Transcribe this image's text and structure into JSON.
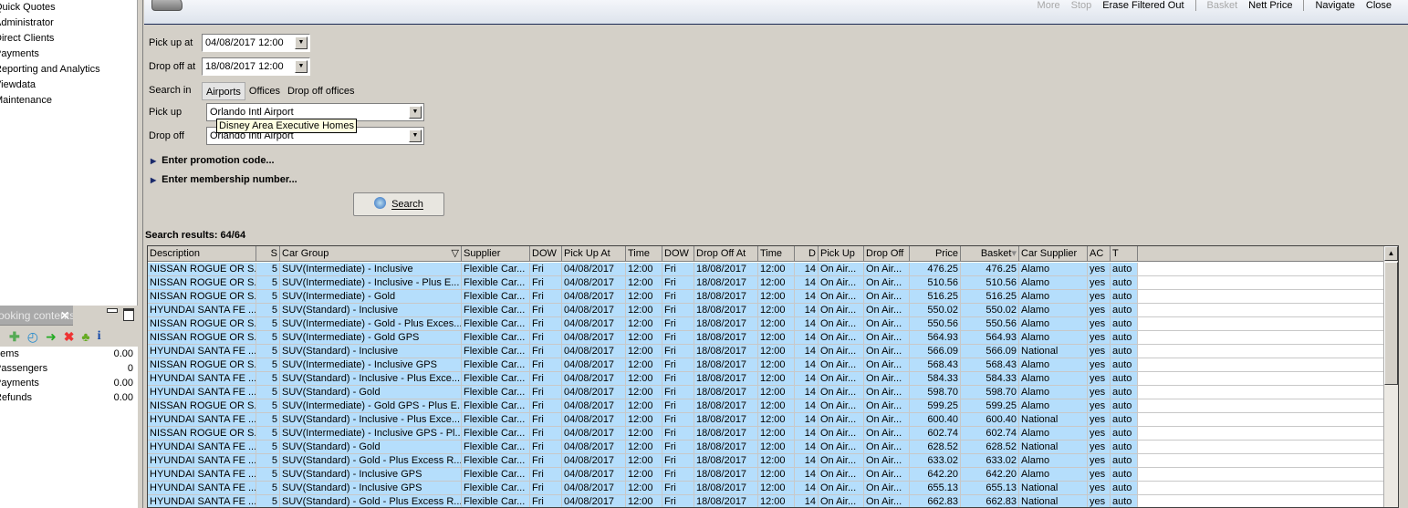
{
  "nav": {
    "items": [
      "Quick Quotes",
      "Administrator",
      "Direct Clients",
      "Payments",
      "Reporting and Analytics",
      "Viewdata",
      "Maintenance"
    ]
  },
  "booking_panel": {
    "tab_label": "Booking contents",
    "tools": [
      "add-icon",
      "clock-icon",
      "cart-transfer-icon",
      "delete-icon",
      "palm-island-icon",
      "info-icon"
    ],
    "rows": [
      {
        "label": "Items",
        "value": "0.00"
      },
      {
        "label": "Passengers",
        "value": "0"
      },
      {
        "label": "Payments",
        "value": "0.00"
      },
      {
        "label": "Refunds",
        "value": "0.00"
      }
    ]
  },
  "toolbar": {
    "more": "More",
    "stop": "Stop",
    "erase": "Erase Filtered Out",
    "basket": "Basket",
    "nett": "Nett Price",
    "navigate": "Navigate",
    "close": "Close"
  },
  "form": {
    "pickup_at_label": "Pick up at",
    "pickup_at": "04/08/2017 12:00",
    "dropoff_at_label": "Drop off at",
    "dropoff_at": "18/08/2017 12:00",
    "search_in_label": "Search in",
    "search_in_options": [
      "Airports",
      "Offices",
      "Drop off offices"
    ],
    "search_in_selected": "Airports",
    "pickup_label": "Pick up",
    "pickup": "Orlando Intl Airport",
    "dropoff_label": "Drop off",
    "dropoff": "Orlando Intl Airport",
    "tooltip": "Disney Area Executive Homes",
    "promo": "Enter promotion code...",
    "membership": "Enter membership number...",
    "search_button": "Search"
  },
  "results": {
    "title": "Search results: 64/64",
    "columns": [
      "Description",
      "S",
      "Car Group",
      "Supplier",
      "DOW",
      "Pick Up At",
      "Time",
      "DOW",
      "Drop Off At",
      "Time",
      "D",
      "Pick Up",
      "Drop Off",
      "Price",
      "Basket",
      "Car Supplier",
      "AC",
      "T"
    ],
    "rows": [
      [
        "NISSAN ROGUE OR S...",
        "5",
        "SUV(Intermediate) - Inclusive",
        "Flexible Car...",
        "Fri",
        "04/08/2017",
        "12:00",
        "Fri",
        "18/08/2017",
        "12:00",
        "14",
        "On Air...",
        "On Air...",
        "476.25",
        "476.25",
        "Alamo",
        "yes",
        "auto"
      ],
      [
        "NISSAN ROGUE OR S...",
        "5",
        "SUV(Intermediate) - Inclusive - Plus E...",
        "Flexible Car...",
        "Fri",
        "04/08/2017",
        "12:00",
        "Fri",
        "18/08/2017",
        "12:00",
        "14",
        "On Air...",
        "On Air...",
        "510.56",
        "510.56",
        "Alamo",
        "yes",
        "auto"
      ],
      [
        "NISSAN ROGUE OR S...",
        "5",
        "SUV(Intermediate) - Gold",
        "Flexible Car...",
        "Fri",
        "04/08/2017",
        "12:00",
        "Fri",
        "18/08/2017",
        "12:00",
        "14",
        "On Air...",
        "On Air...",
        "516.25",
        "516.25",
        "Alamo",
        "yes",
        "auto"
      ],
      [
        "HYUNDAI SANTA FE ...",
        "5",
        "SUV(Standard) - Inclusive",
        "Flexible Car...",
        "Fri",
        "04/08/2017",
        "12:00",
        "Fri",
        "18/08/2017",
        "12:00",
        "14",
        "On Air...",
        "On Air...",
        "550.02",
        "550.02",
        "Alamo",
        "yes",
        "auto"
      ],
      [
        "NISSAN ROGUE OR S...",
        "5",
        "SUV(Intermediate) - Gold - Plus Exces...",
        "Flexible Car...",
        "Fri",
        "04/08/2017",
        "12:00",
        "Fri",
        "18/08/2017",
        "12:00",
        "14",
        "On Air...",
        "On Air...",
        "550.56",
        "550.56",
        "Alamo",
        "yes",
        "auto"
      ],
      [
        "NISSAN ROGUE OR S...",
        "5",
        "SUV(Intermediate) - Gold GPS",
        "Flexible Car...",
        "Fri",
        "04/08/2017",
        "12:00",
        "Fri",
        "18/08/2017",
        "12:00",
        "14",
        "On Air...",
        "On Air...",
        "564.93",
        "564.93",
        "Alamo",
        "yes",
        "auto"
      ],
      [
        "HYUNDAI SANTA FE ...",
        "5",
        "SUV(Standard) - Inclusive",
        "Flexible Car...",
        "Fri",
        "04/08/2017",
        "12:00",
        "Fri",
        "18/08/2017",
        "12:00",
        "14",
        "On Air...",
        "On Air...",
        "566.09",
        "566.09",
        "National",
        "yes",
        "auto"
      ],
      [
        "NISSAN ROGUE OR S...",
        "5",
        "SUV(Intermediate) - Inclusive GPS",
        "Flexible Car...",
        "Fri",
        "04/08/2017",
        "12:00",
        "Fri",
        "18/08/2017",
        "12:00",
        "14",
        "On Air...",
        "On Air...",
        "568.43",
        "568.43",
        "Alamo",
        "yes",
        "auto"
      ],
      [
        "HYUNDAI SANTA FE ...",
        "5",
        "SUV(Standard) - Inclusive - Plus Exce...",
        "Flexible Car...",
        "Fri",
        "04/08/2017",
        "12:00",
        "Fri",
        "18/08/2017",
        "12:00",
        "14",
        "On Air...",
        "On Air...",
        "584.33",
        "584.33",
        "Alamo",
        "yes",
        "auto"
      ],
      [
        "HYUNDAI SANTA FE ...",
        "5",
        "SUV(Standard) - Gold",
        "Flexible Car...",
        "Fri",
        "04/08/2017",
        "12:00",
        "Fri",
        "18/08/2017",
        "12:00",
        "14",
        "On Air...",
        "On Air...",
        "598.70",
        "598.70",
        "Alamo",
        "yes",
        "auto"
      ],
      [
        "NISSAN ROGUE OR S...",
        "5",
        "SUV(Intermediate) - Gold GPS - Plus E...",
        "Flexible Car...",
        "Fri",
        "04/08/2017",
        "12:00",
        "Fri",
        "18/08/2017",
        "12:00",
        "14",
        "On Air...",
        "On Air...",
        "599.25",
        "599.25",
        "Alamo",
        "yes",
        "auto"
      ],
      [
        "HYUNDAI SANTA FE ...",
        "5",
        "SUV(Standard) - Inclusive - Plus Exce...",
        "Flexible Car...",
        "Fri",
        "04/08/2017",
        "12:00",
        "Fri",
        "18/08/2017",
        "12:00",
        "14",
        "On Air...",
        "On Air...",
        "600.40",
        "600.40",
        "National",
        "yes",
        "auto"
      ],
      [
        "NISSAN ROGUE OR S...",
        "5",
        "SUV(Intermediate) - Inclusive GPS - Pl...",
        "Flexible Car...",
        "Fri",
        "04/08/2017",
        "12:00",
        "Fri",
        "18/08/2017",
        "12:00",
        "14",
        "On Air...",
        "On Air...",
        "602.74",
        "602.74",
        "Alamo",
        "yes",
        "auto"
      ],
      [
        "HYUNDAI SANTA FE ...",
        "5",
        "SUV(Standard) - Gold",
        "Flexible Car...",
        "Fri",
        "04/08/2017",
        "12:00",
        "Fri",
        "18/08/2017",
        "12:00",
        "14",
        "On Air...",
        "On Air...",
        "628.52",
        "628.52",
        "National",
        "yes",
        "auto"
      ],
      [
        "HYUNDAI SANTA FE ...",
        "5",
        "SUV(Standard) - Gold - Plus Excess R...",
        "Flexible Car...",
        "Fri",
        "04/08/2017",
        "12:00",
        "Fri",
        "18/08/2017",
        "12:00",
        "14",
        "On Air...",
        "On Air...",
        "633.02",
        "633.02",
        "Alamo",
        "yes",
        "auto"
      ],
      [
        "HYUNDAI SANTA FE ...",
        "5",
        "SUV(Standard) - Inclusive GPS",
        "Flexible Car...",
        "Fri",
        "04/08/2017",
        "12:00",
        "Fri",
        "18/08/2017",
        "12:00",
        "14",
        "On Air...",
        "On Air...",
        "642.20",
        "642.20",
        "Alamo",
        "yes",
        "auto"
      ],
      [
        "HYUNDAI SANTA FE ...",
        "5",
        "SUV(Standard) - Inclusive GPS",
        "Flexible Car...",
        "Fri",
        "04/08/2017",
        "12:00",
        "Fri",
        "18/08/2017",
        "12:00",
        "14",
        "On Air...",
        "On Air...",
        "655.13",
        "655.13",
        "National",
        "yes",
        "auto"
      ],
      [
        "HYUNDAI SANTA FE ...",
        "5",
        "SUV(Standard) - Gold - Plus Excess R...",
        "Flexible Car...",
        "Fri",
        "04/08/2017",
        "12:00",
        "Fri",
        "18/08/2017",
        "12:00",
        "14",
        "On Air...",
        "On Air...",
        "662.83",
        "662.83",
        "National",
        "yes",
        "auto"
      ]
    ]
  },
  "colors": {
    "row_bg": "#b5defc",
    "window_bg": "#d4d0c8",
    "tooltip_bg": "#ffffe1"
  }
}
